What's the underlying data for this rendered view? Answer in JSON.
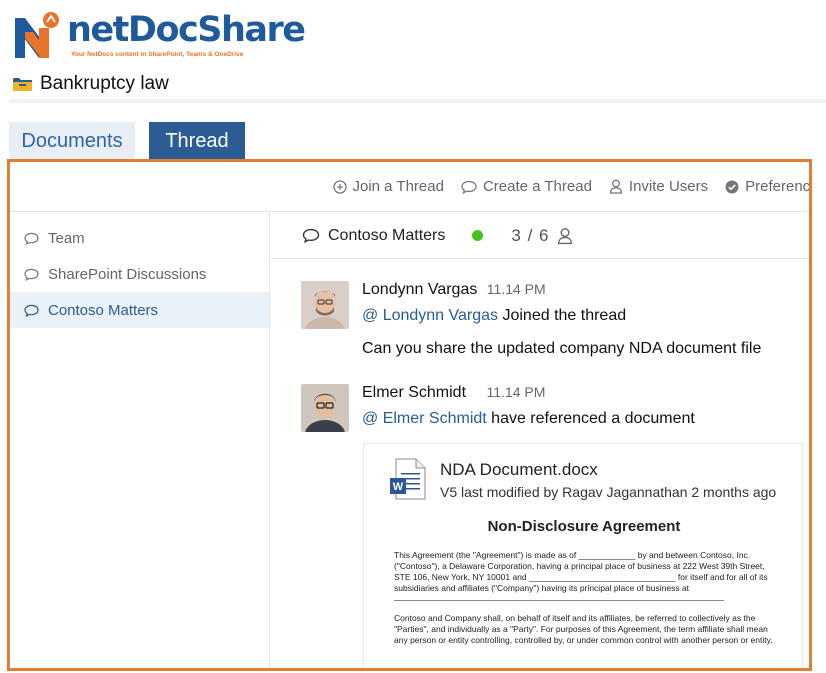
{
  "brand": {
    "name": "netDocShare",
    "tagline": "Your NetDocs content in SharePoint, Teams & OneDrive",
    "colors": {
      "primary": "#1f5a9c",
      "accent": "#e8742a"
    }
  },
  "folder": {
    "title": "Bankruptcy law",
    "icon": "folder-icon"
  },
  "tabs": [
    {
      "label": "Documents",
      "active": false
    },
    {
      "label": "Thread",
      "active": true
    }
  ],
  "toolbar": {
    "join_label": "Join a Thread",
    "create_label": "Create a Thread",
    "invite_label": "Invite Users",
    "prefs_label": "Preferences"
  },
  "sidebar": {
    "items": [
      {
        "label": "Team",
        "active": false
      },
      {
        "label": "SharePoint Discussions",
        "active": false
      },
      {
        "label": "Contoso Matters",
        "active": true
      }
    ]
  },
  "thread": {
    "title": "Contoso Matters",
    "status_color": "#44c21f",
    "member_count": "3 / 6"
  },
  "messages": [
    {
      "name": "Londynn Vargas",
      "time": "11.14 PM",
      "mention": "@ Londynn Vargas",
      "action": " Joined the thread",
      "text": "Can you share the updated company NDA document file"
    },
    {
      "name": "Elmer Schmidt",
      "time": "11.14 PM",
      "mention": "@ Elmer Schmidt",
      "action": " have referenced a document"
    }
  ],
  "document": {
    "name": "NDA Document.docx",
    "meta": "V5 last modified by Ragav Jagannathan 2 months ago",
    "preview_title": "Non-Disclosure Agreement",
    "preview_p1": "This Agreement (the \"Agreement\") is made as of ____________ by and between Contoso, Inc. (\"Contoso\"), a Delaware Corporation, having a principal place of business at 222 West 39th Street, STE 106, New York, NY 10001 and _______________________________ for itself and for all of its subsidiaries and affiliates (\"Company\") having its principal place of business at",
    "preview_p2": "Contoso and Company shall, on behalf of itself and its affiliates, be referred to collectively as the \"Parties\", and individually as a \"Party\". For purposes of this Agreement, the term affiliate shall mean any person or entity controlling, controlled by, or under common control with another person or entity."
  }
}
